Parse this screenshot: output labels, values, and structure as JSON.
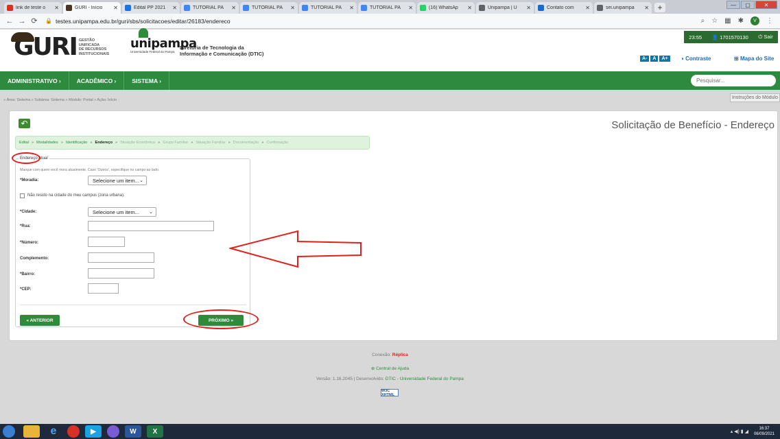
{
  "browser": {
    "tabs": [
      {
        "label": "link de teste o",
        "icon": "gmail-icon",
        "color": "#d93025",
        "active": false
      },
      {
        "label": "GURI - Início",
        "icon": "guri-icon",
        "color": "#4a3520",
        "active": true
      },
      {
        "label": "Edital PP 2021",
        "icon": "drive-icon",
        "color": "#1a73e8",
        "active": false
      },
      {
        "label": "TUTORIAL PA",
        "icon": "docs-icon",
        "color": "#4285f4",
        "active": false
      },
      {
        "label": "TUTORIAL PA",
        "icon": "docs-icon",
        "color": "#4285f4",
        "active": false
      },
      {
        "label": "TUTORIAL PA",
        "icon": "docs-icon",
        "color": "#4285f4",
        "active": false
      },
      {
        "label": "TUTORIAL PA",
        "icon": "docs-icon",
        "color": "#4285f4",
        "active": false
      },
      {
        "label": "(16) WhatsAp",
        "icon": "whatsapp-icon",
        "color": "#25d366",
        "active": false
      },
      {
        "label": "Unipampa | U",
        "icon": "globe-icon",
        "color": "#5f6368",
        "active": false
      },
      {
        "label": "Contato com",
        "icon": "contact-icon",
        "color": "#1b6ac9",
        "active": false
      },
      {
        "label": "sei.unipampa",
        "icon": "globe-icon",
        "color": "#5f6368",
        "active": false
      }
    ],
    "new_tab": "+",
    "url": "testes.unipampa.edu.br/guri/sbs/solicitacoes/editar/26183/endereco",
    "avatar_letter": "V"
  },
  "header": {
    "guri_logo": "GURI",
    "guri_subtitle": [
      "GESTÃO",
      "UNIFICADA",
      "DE RECURSOS",
      "INSTITUCIONAIS"
    ],
    "unipampa_logo": "unipampa",
    "unipampa_subtitle": "Universidade Federal do Pampa",
    "dtic_line1": "Diretoria de Tecnologia da",
    "dtic_line2": "Informação e Comunicação (DTIC)",
    "time": "23:55",
    "user_id": "1701570130",
    "logout": "Sair",
    "font_sizes": [
      "A-",
      "A",
      "A+"
    ],
    "contrast": "Contraste",
    "sitemap": "Mapa do Site"
  },
  "menu": {
    "items": [
      "ADMINISTRATIVO ›",
      "ACADÊMICO ›",
      "SISTEMA ›"
    ],
    "search_placeholder": "Pesquisar..."
  },
  "breadcrumb": "» Área: Sistema » Subárea: Sistema » Módulo: Portal » Ação: Início",
  "help_button": "Instruções do Módulo",
  "page": {
    "title": "Solicitação de Benefício - Endereço",
    "steps": [
      {
        "label": "Edital",
        "state": "done"
      },
      {
        "label": "Modalidades",
        "state": "done"
      },
      {
        "label": "Identificação",
        "state": "done"
      },
      {
        "label": "Endereço",
        "state": "current"
      },
      {
        "label": "Situação Econômica",
        "state": "future"
      },
      {
        "label": "Grupo Familiar",
        "state": "future"
      },
      {
        "label": "Situação Familiar",
        "state": "future"
      },
      {
        "label": "Documentação",
        "state": "future"
      },
      {
        "label": "Confirmação",
        "state": "future"
      }
    ],
    "step_separator": "»"
  },
  "form": {
    "legend": "Endereço Atual",
    "hint": "Marque com quem você mora atualmente. Caso 'Outros', especifique no campo ao lado.",
    "moradia_label": "*Moradia:",
    "moradia_value": "Selecione um item...",
    "not_in_city_label": "Não resido na cidade do meu campus (zona urbana).",
    "cidade_label": "*Cidade:",
    "cidade_value": "Selecione um item...",
    "rua_label": "*Rua:",
    "numero_label": "*Número:",
    "complemento_label": "Complemento:",
    "bairro_label": "*Bairro:",
    "cep_label": "*CEP:",
    "prev_button": "«   ANTERIOR",
    "next_button": "PRÓXIMO   »"
  },
  "footer": {
    "connection_label": "Conexão:",
    "connection_value": "Réplica",
    "help_center": "Central de Ajuda",
    "version_text": "Versão: 1.16.2045 | Desenvolvido:",
    "developer": "DTIC - Universidade Federal do Pampa",
    "w3c_badge": "W3C XHTML"
  },
  "taskbar": {
    "time": "16:37",
    "date": "06/09/2021"
  },
  "colors": {
    "brand_green": "#2d8a3e",
    "annotation_red": "#e0201b"
  }
}
